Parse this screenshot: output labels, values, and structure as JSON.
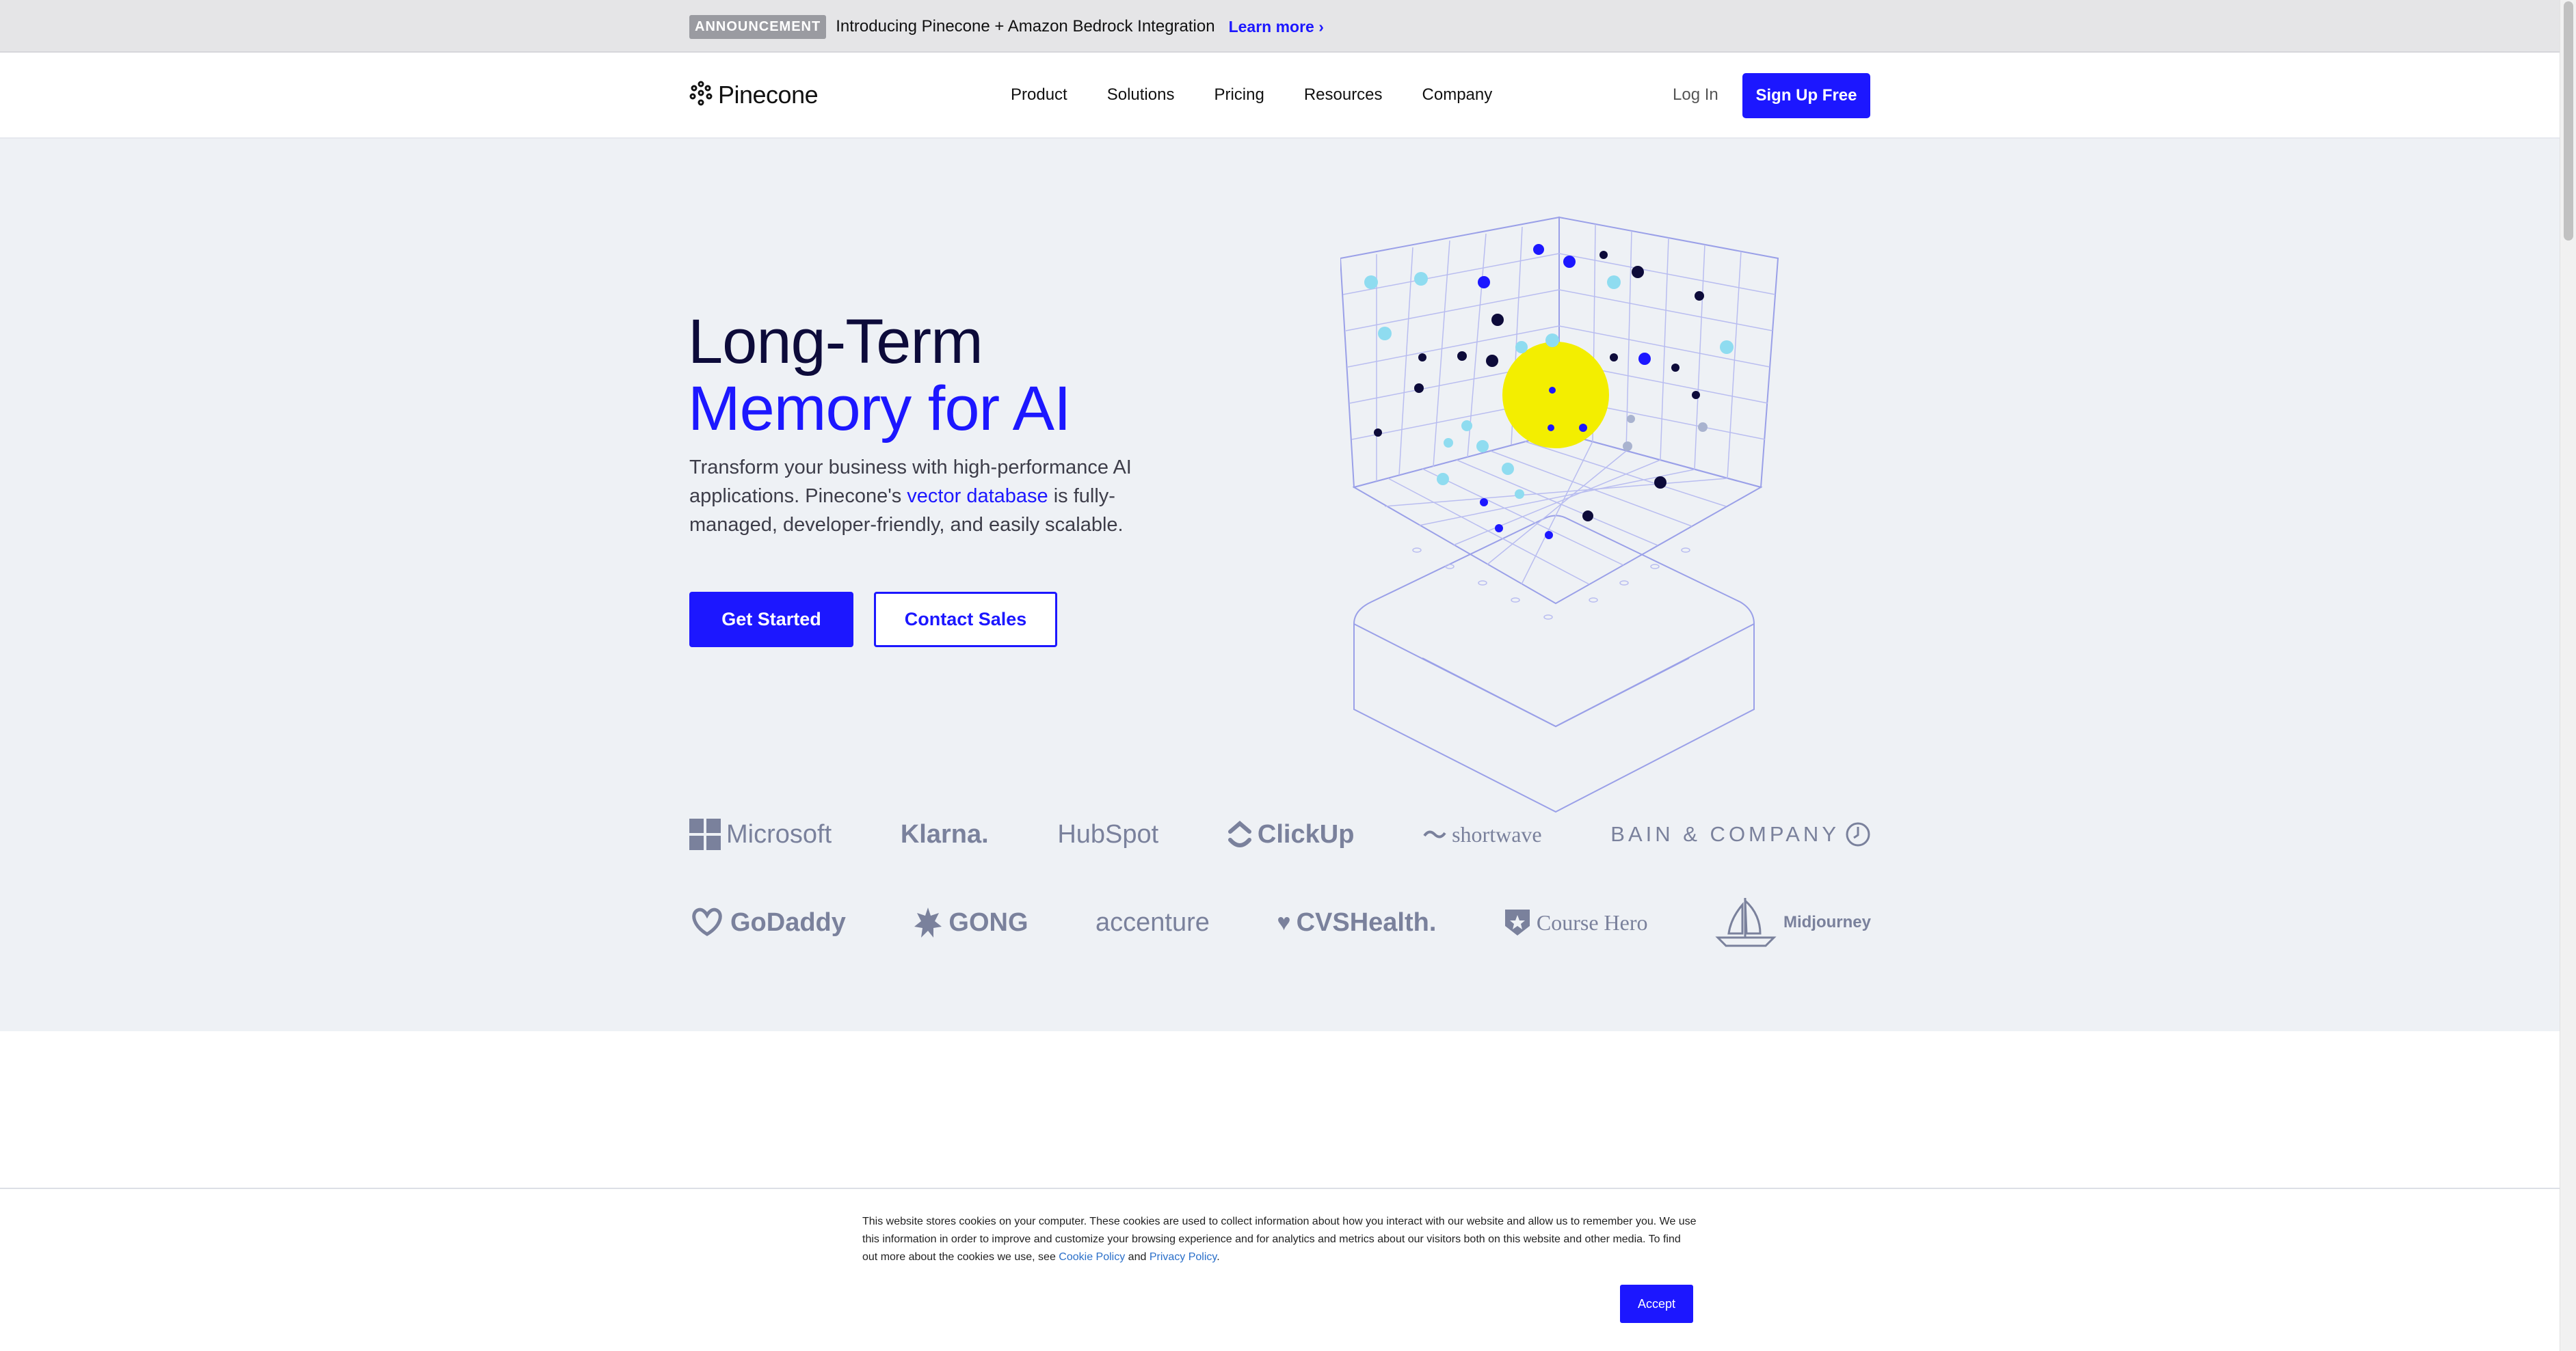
{
  "announcement": {
    "badge": "ANNOUNCEMENT",
    "text": "Introducing Pinecone + Amazon Bedrock Integration",
    "link": "Learn more ›"
  },
  "nav": {
    "logo": "Pinecone",
    "links": [
      "Product",
      "Solutions",
      "Pricing",
      "Resources",
      "Company"
    ],
    "login": "Log In",
    "signup": "Sign Up Free"
  },
  "hero": {
    "title_line1": "Long-Term",
    "title_line2": "Memory for AI",
    "desc_before": "Transform your business with high-performance AI applications. Pinecone's ",
    "desc_link": "vector database",
    "desc_after": " is fully-managed, developer-friendly, and easily scalable.",
    "cta_primary": "Get Started",
    "cta_secondary": "Contact Sales"
  },
  "customer_logos": {
    "row1": [
      "Microsoft",
      "Klarna.",
      "HubSpot",
      "ClickUp",
      "shortwave",
      "BAIN & COMPANY"
    ],
    "row2": [
      "GoDaddy",
      "GONG",
      "accenture",
      "CVSHealth.",
      "Course Hero",
      "Midjourney"
    ]
  },
  "cookie": {
    "text": "This website stores cookies on your computer. These cookies are used to collect information about how you interact with our website and allow us to remember you. We use this information in order to improve and customize your browsing experience and for analytics and metrics about our visitors both on this website and other media. To find out more about the cookies we use, see ",
    "cookie_policy": "Cookie Policy",
    "and": " and ",
    "privacy_policy": "Privacy Policy",
    "end": ".",
    "accept": "Accept"
  },
  "colors": {
    "brand_blue": "#1c17ff",
    "navy": "#0d0b3a",
    "hero_bg": "#eef1f5",
    "logo_gray": "#7a819c",
    "highlight_yellow": "#f3ee00"
  }
}
